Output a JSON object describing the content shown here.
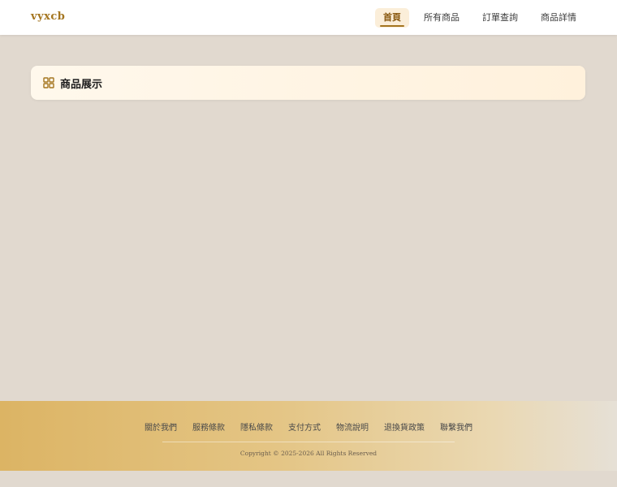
{
  "header": {
    "logo": "vyxcb",
    "nav": [
      {
        "label": "首頁",
        "active": true
      },
      {
        "label": "所有商品",
        "active": false
      },
      {
        "label": "訂單查詢",
        "active": false
      },
      {
        "label": "商品詳情",
        "active": false
      }
    ]
  },
  "section": {
    "icon": "grid-icon",
    "title": "商品展示"
  },
  "footer": {
    "links": [
      "關於我們",
      "服務條款",
      "隱私條款",
      "支付方式",
      "物流說明",
      "退換貨政策",
      "聯繫我們"
    ],
    "copyright": "Copyright © 2025-2026 All Rights Reserved"
  },
  "colors": {
    "accent": "#a4751f",
    "background": "#e1d9cf",
    "footer_start": "#dcb464"
  }
}
